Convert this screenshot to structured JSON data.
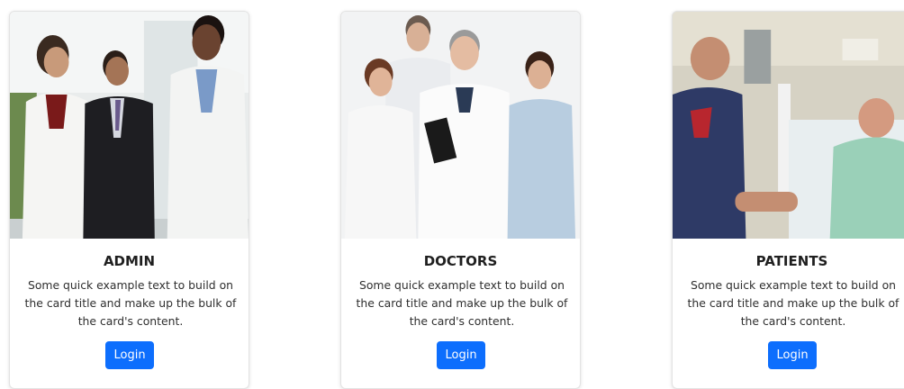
{
  "cards": [
    {
      "image_alt": "Doctors in conversation with businessman",
      "title": "ADMIN",
      "text": "Some quick example text to build on the card title and make up the bulk of the card's content.",
      "button": "Login"
    },
    {
      "image_alt": "Group of smiling doctors and nurses",
      "title": "DOCTORS",
      "text": "Some quick example text to build on the card title and make up the bulk of the card's content.",
      "button": "Login"
    },
    {
      "image_alt": "Patient in hospital bed with visitor",
      "title": "PATIENTS",
      "text": "Some quick example text to build on the card title and make up the bulk of the card's content.",
      "button": "Login"
    }
  ],
  "colors": {
    "button_bg": "#0d6efd",
    "button_text": "#ffffff",
    "card_border": "#e3e3e3"
  }
}
